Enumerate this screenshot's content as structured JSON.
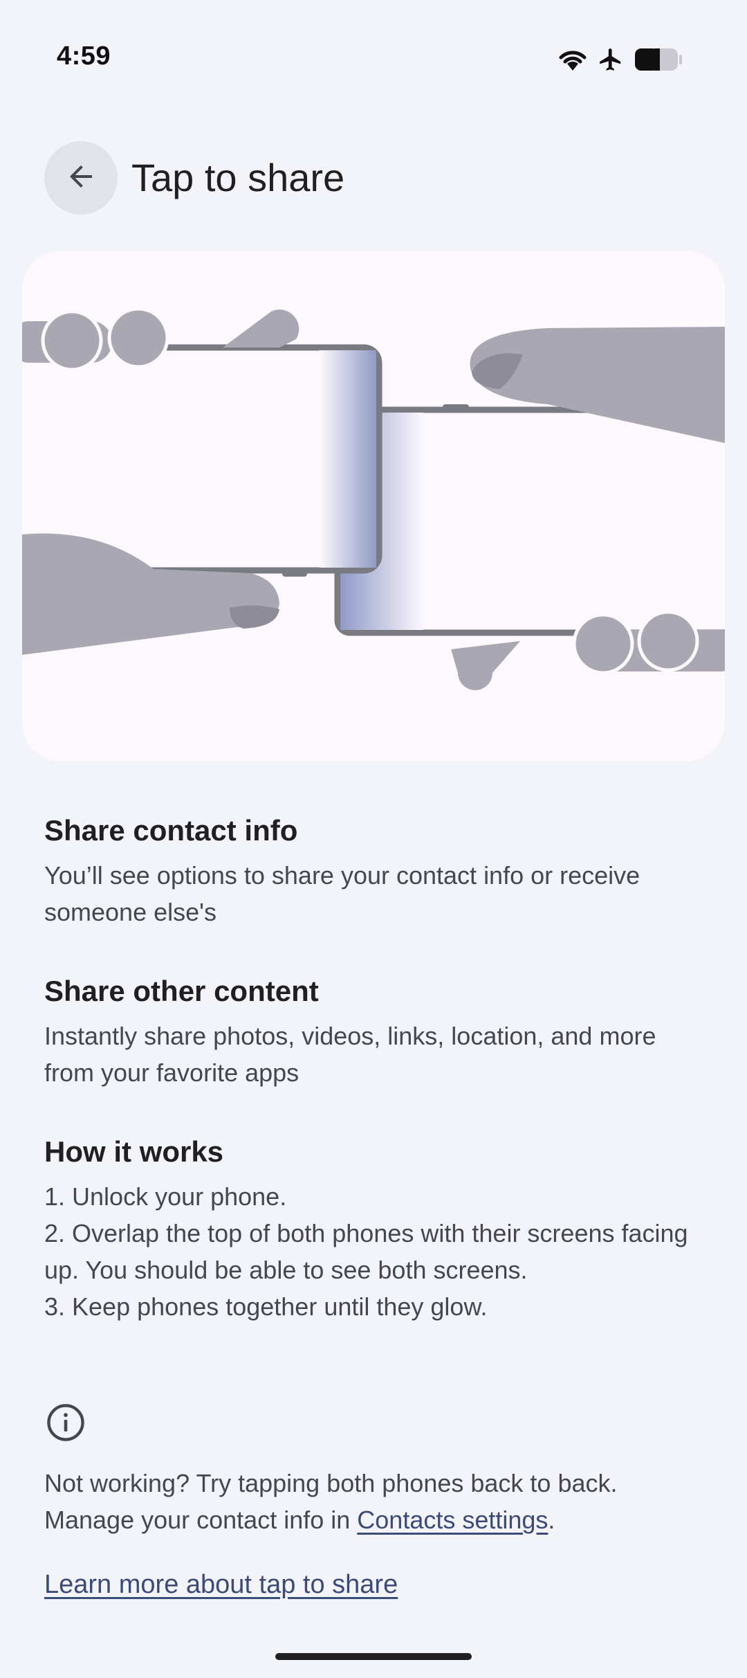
{
  "status_bar": {
    "time": "4:59",
    "icons": [
      "wifi-icon",
      "airplane-mode-icon",
      "battery-icon"
    ]
  },
  "app_bar": {
    "back_icon": "arrow-back-icon",
    "title": "Tap to share"
  },
  "illustration": {
    "description_icon": "two-phones-tap-illustration",
    "colors": {
      "hand": "#a9a8b2",
      "hand_shade": "#8e8d97",
      "phone_frame": "#7a7a82",
      "glow": "#8f9ac6",
      "card_bg": "#fcf8fd"
    }
  },
  "sections": [
    {
      "title": "Share contact info",
      "body": "You’ll see options to share your contact info or receive someone else's"
    },
    {
      "title": "Share other content",
      "body": "Instantly share photos, videos, links, location, and more from your favorite apps"
    }
  ],
  "how_it_works": {
    "title": "How it works",
    "steps": [
      "1. Unlock your phone.",
      "2. Overlap the top of both phones with their screens facing up. You should be able to see both screens.",
      "3. Keep phones together until they glow."
    ]
  },
  "footer": {
    "info_icon": "info-icon",
    "line1": "Not working? Try tapping both phones back to back.",
    "line2_prefix": "Manage your contact info in ",
    "contacts_link": "Contacts settings",
    "line2_suffix": ".",
    "learn_more": "Learn more about tap to share"
  },
  "colors": {
    "background": "#f3f4f9",
    "link": "#3b4a78",
    "text_primary": "#1f1f24",
    "text_secondary": "#45464f"
  }
}
